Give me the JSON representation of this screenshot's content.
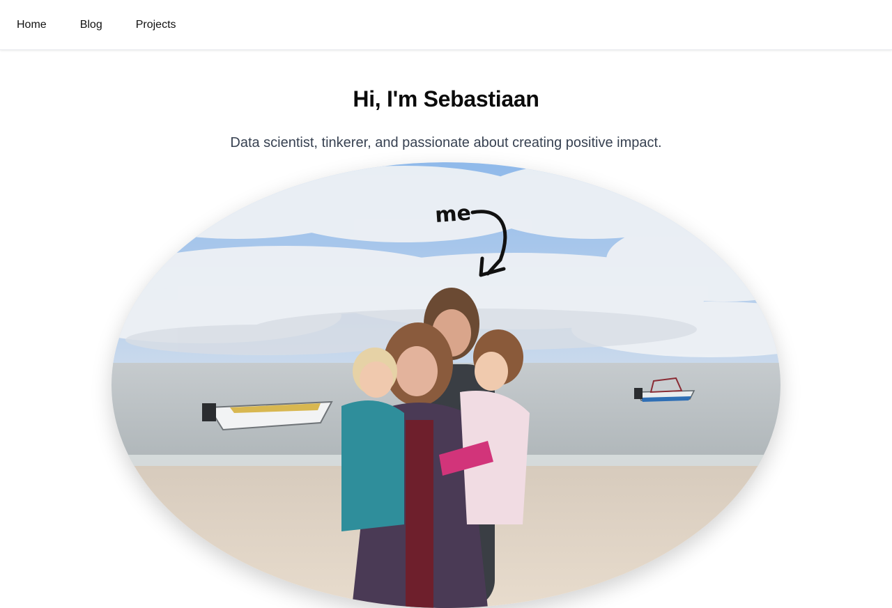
{
  "nav": {
    "items": [
      {
        "label": "Home"
      },
      {
        "label": "Blog"
      },
      {
        "label": "Projects"
      }
    ]
  },
  "hero": {
    "title": "Hi, I'm Sebastiaan",
    "subtitle": "Data scientist, tinkerer, and passionate about creating positive impact.",
    "photo_annotation": "me"
  },
  "colors": {
    "sky": "#9dc4ef",
    "sea": "#bfc6c9",
    "sand": "#e3d5c4",
    "text_muted": "#374151"
  }
}
